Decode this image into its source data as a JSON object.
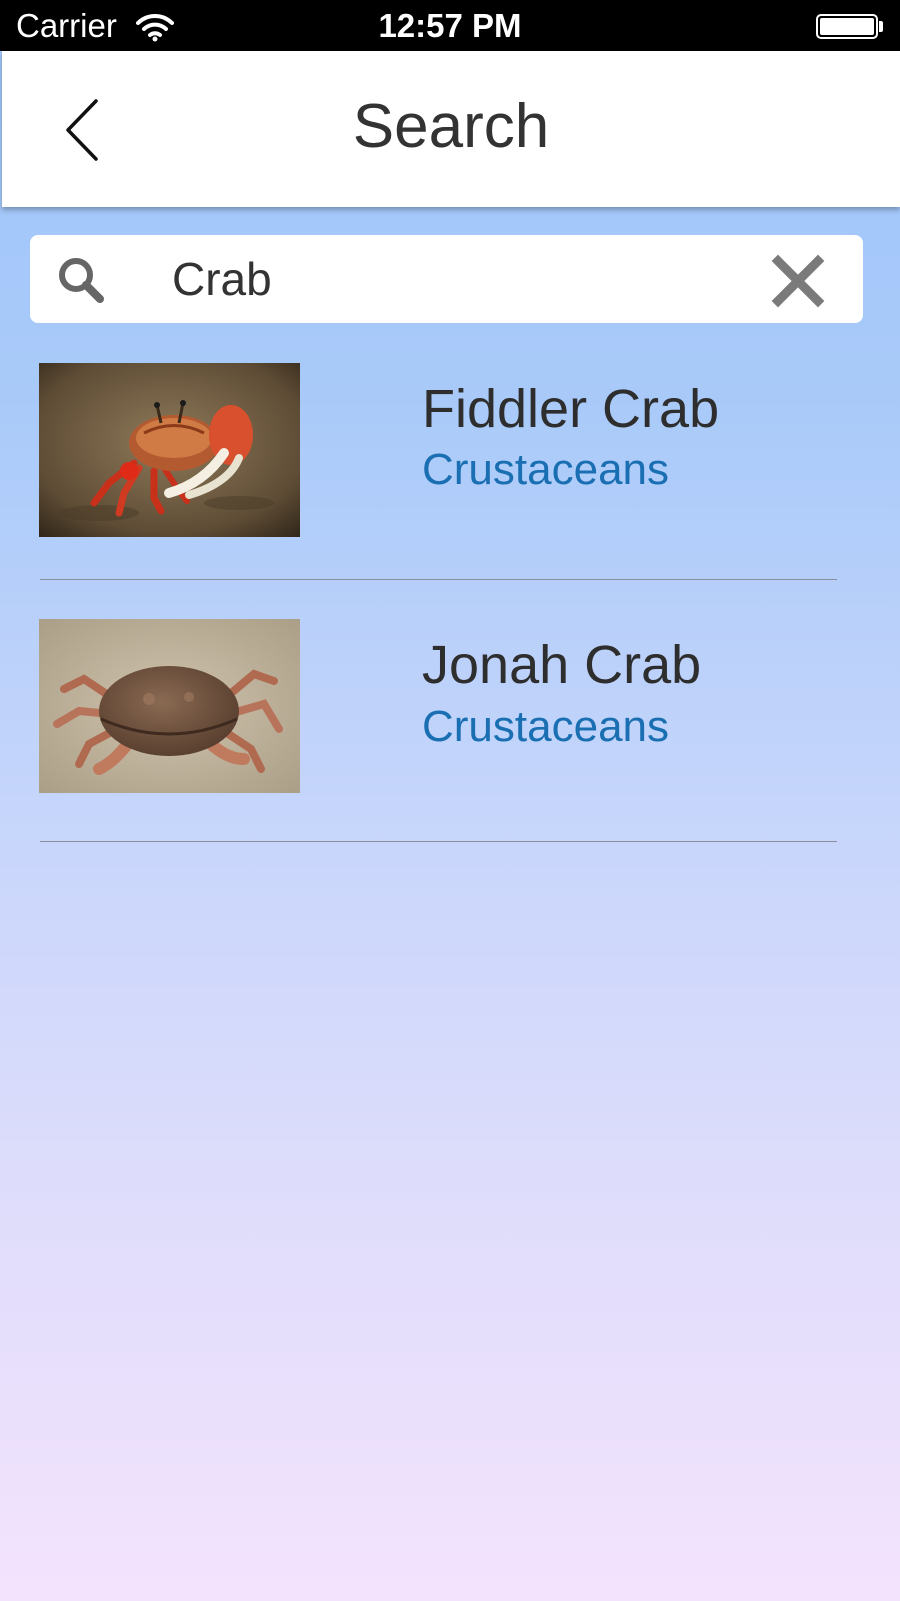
{
  "status_bar": {
    "carrier": "Carrier",
    "time": "12:57 PM",
    "wifi_icon": "wifi-icon",
    "battery_icon": "battery-full-icon",
    "battery_level": 1.0
  },
  "header": {
    "title": "Search",
    "back_icon": "chevron-left-icon"
  },
  "search": {
    "value": "Crab",
    "search_icon": "search-icon",
    "clear_icon": "close-icon"
  },
  "results": [
    {
      "name": "Fiddler Crab",
      "category": "Crustaceans",
      "thumbnail": "fiddler-crab-photo"
    },
    {
      "name": "Jonah Crab",
      "category": "Crustaceans",
      "thumbnail": "jonah-crab-photo"
    }
  ],
  "colors": {
    "status_bar_bg": "#000000",
    "header_bg": "#ffffff",
    "title_text": "#333333",
    "result_name_text": "#2e2e2e",
    "category_text": "#1a6fb3",
    "divider": "#8a8f9a",
    "gradient_top": "#9fc5fb",
    "gradient_bottom": "#f4e3fd"
  }
}
